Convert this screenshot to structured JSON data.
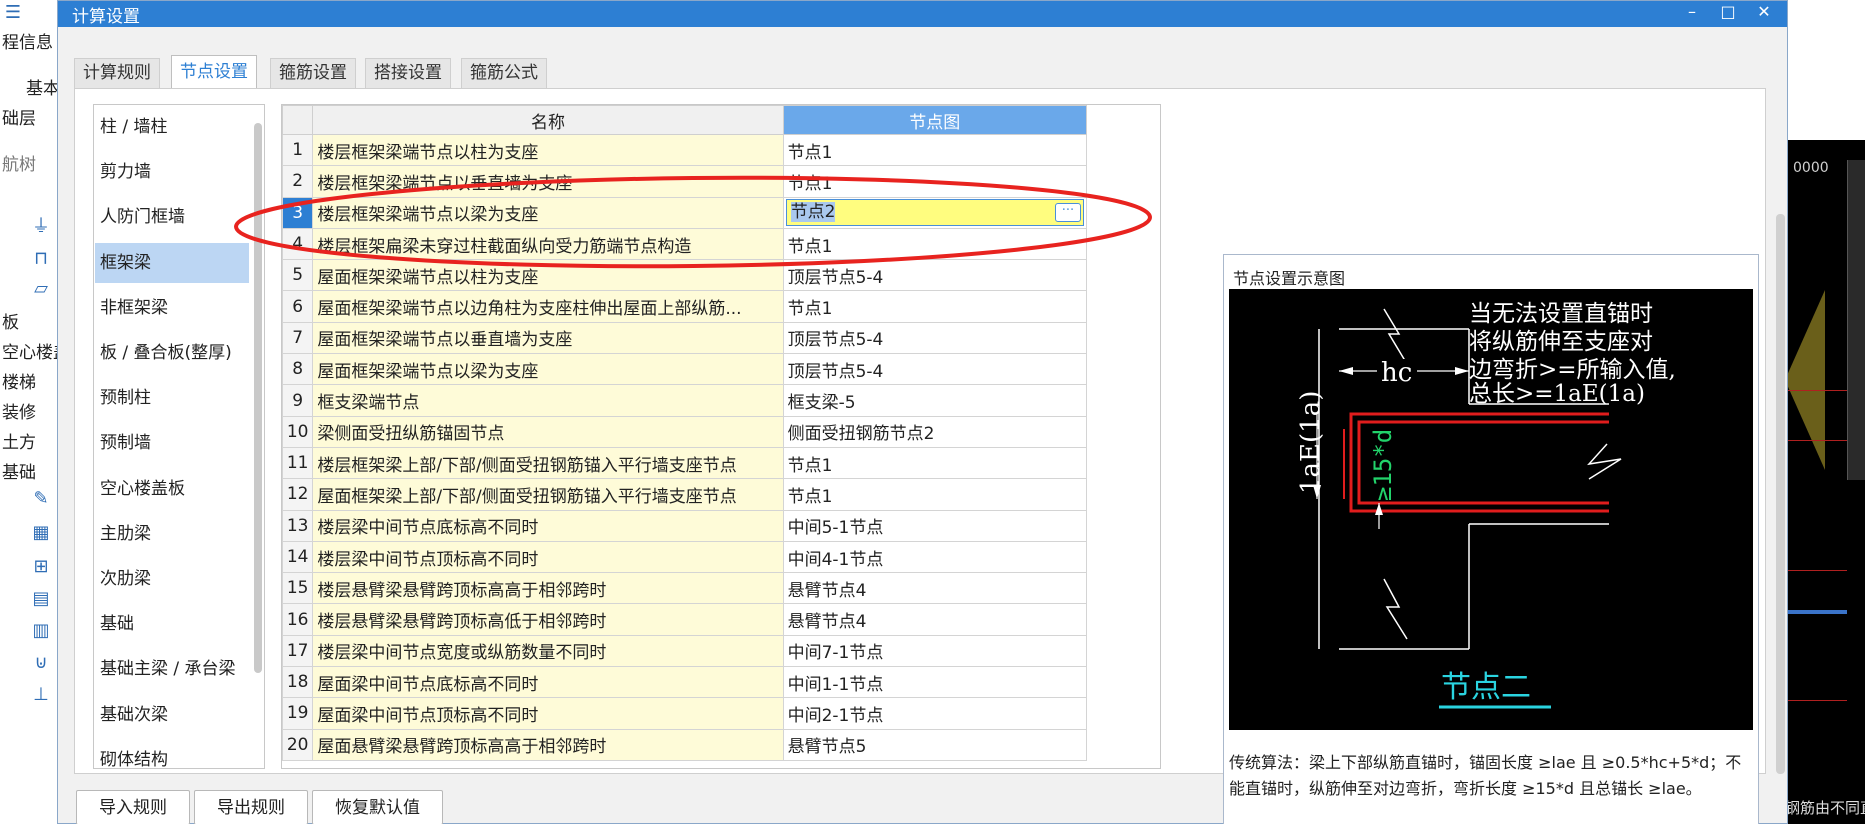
{
  "background_app": {
    "left_labels": [
      "程信息",
      "基本",
      "础层",
      "航树",
      "板",
      "空心楼盖",
      "楼梯",
      "装修",
      "土方",
      "基础"
    ],
    "right_cad_text": "0000",
    "right_bottom_text": "钢筋由不同直径"
  },
  "dialog": {
    "title": "计算设置",
    "window_buttons": {
      "minimize": "–",
      "maximize": "□",
      "close": "✕"
    }
  },
  "tabs": [
    {
      "label": "计算规则",
      "active": false
    },
    {
      "label": "节点设置",
      "active": true
    },
    {
      "label": "箍筋设置",
      "active": false
    },
    {
      "label": "搭接设置",
      "active": false
    },
    {
      "label": "箍筋公式",
      "active": false
    }
  ],
  "categories": [
    {
      "label": "柱 / 墙柱",
      "selected": false
    },
    {
      "label": "剪力墙",
      "selected": false
    },
    {
      "label": "人防门框墙",
      "selected": false
    },
    {
      "label": "框架梁",
      "selected": true
    },
    {
      "label": "非框架梁",
      "selected": false
    },
    {
      "label": "板 / 叠合板(整厚)",
      "selected": false
    },
    {
      "label": "预制柱",
      "selected": false
    },
    {
      "label": "预制墙",
      "selected": false
    },
    {
      "label": "空心楼盖板",
      "selected": false
    },
    {
      "label": "主肋梁",
      "selected": false
    },
    {
      "label": "次肋梁",
      "selected": false
    },
    {
      "label": "基础",
      "selected": false
    },
    {
      "label": "基础主梁 / 承台梁",
      "selected": false
    },
    {
      "label": "基础次梁",
      "selected": false
    },
    {
      "label": "砌体结构",
      "selected": false
    }
  ],
  "table": {
    "headers": {
      "index": "",
      "name": "名称",
      "node": "节点图"
    },
    "current_row": 3,
    "rows": [
      {
        "num": "1",
        "name": "楼层框架梁端节点以柱为支座",
        "node": "节点1"
      },
      {
        "num": "2",
        "name": "楼层框架梁端节点以垂直墙为支座",
        "node": "节点1"
      },
      {
        "num": "3",
        "name": "楼层框架梁端节点以梁为支座",
        "node": "节点2"
      },
      {
        "num": "4",
        "name": "楼层框架扁梁未穿过柱截面纵向受力筋端节点构造",
        "node": "节点1"
      },
      {
        "num": "5",
        "name": "屋面框架梁端节点以柱为支座",
        "node": "顶层节点5-4"
      },
      {
        "num": "6",
        "name": "屋面框架梁端节点以边角柱为支座柱伸出屋面上部纵筋...",
        "node": "节点1"
      },
      {
        "num": "7",
        "name": "屋面框架梁端节点以垂直墙为支座",
        "node": "顶层节点5-4"
      },
      {
        "num": "8",
        "name": "屋面框架梁端节点以梁为支座",
        "node": "顶层节点5-4"
      },
      {
        "num": "9",
        "name": "框支梁端节点",
        "node": "框支梁-5"
      },
      {
        "num": "10",
        "name": "梁侧面受扭纵筋锚固节点",
        "node": "侧面受扭钢筋节点2"
      },
      {
        "num": "11",
        "name": "楼层框架梁上部/下部/侧面受扭钢筋锚入平行墙支座节点",
        "node": "节点1"
      },
      {
        "num": "12",
        "name": "屋面框架梁上部/下部/侧面受扭钢筋锚入平行墙支座节点",
        "node": "节点1"
      },
      {
        "num": "13",
        "name": "楼层梁中间节点底标高不同时",
        "node": "中间5-1节点"
      },
      {
        "num": "14",
        "name": "楼层梁中间节点顶标高不同时",
        "node": "中间4-1节点"
      },
      {
        "num": "15",
        "name": "楼层悬臂梁悬臂跨顶标高高于相邻跨时",
        "node": "悬臂节点4"
      },
      {
        "num": "16",
        "name": "楼层悬臂梁悬臂跨顶标高低于相邻跨时",
        "node": "悬臂节点4"
      },
      {
        "num": "17",
        "name": "楼层梁中间节点宽度或纵筋数量不同时",
        "node": "中间7-1节点"
      },
      {
        "num": "18",
        "name": "屋面梁中间节点底标高不同时",
        "node": "中间1-1节点"
      },
      {
        "num": "19",
        "name": "屋面梁中间节点顶标高不同时",
        "node": "中间2-1节点"
      },
      {
        "num": "20",
        "name": "屋面悬臂梁悬臂跨顶标高高于相邻跨时",
        "node": "悬臂节点5"
      }
    ],
    "edit_button_label": "···"
  },
  "preview": {
    "title": "节点设置示意图",
    "diagram": {
      "note_lines": [
        "当无法设置直锚时",
        "将纵筋伸至支座对",
        "边弯折>=所输入值,",
        "总长>=1aE(1a)"
      ],
      "hc_label": "hc",
      "lae_label": "1aE(1a)",
      "bend_label": "≥15*d",
      "caption": "节点二"
    },
    "description": "传统算法：梁上下部纵筋直锚时，锚固长度 ≥lae 且 ≥0.5*hc+5*d；不能直锚时，纵筋伸至对边弯折，弯折长度 ≥15*d 且总锚长 ≥lae。"
  },
  "buttons": {
    "import": "导入规则",
    "export": "导出规则",
    "restore": "恢复默认值"
  },
  "colors": {
    "accent": "#2d7fd3",
    "annotation": "#e8231f",
    "name_cell": "#fefbd8",
    "edit_cell": "#fffd7f"
  }
}
